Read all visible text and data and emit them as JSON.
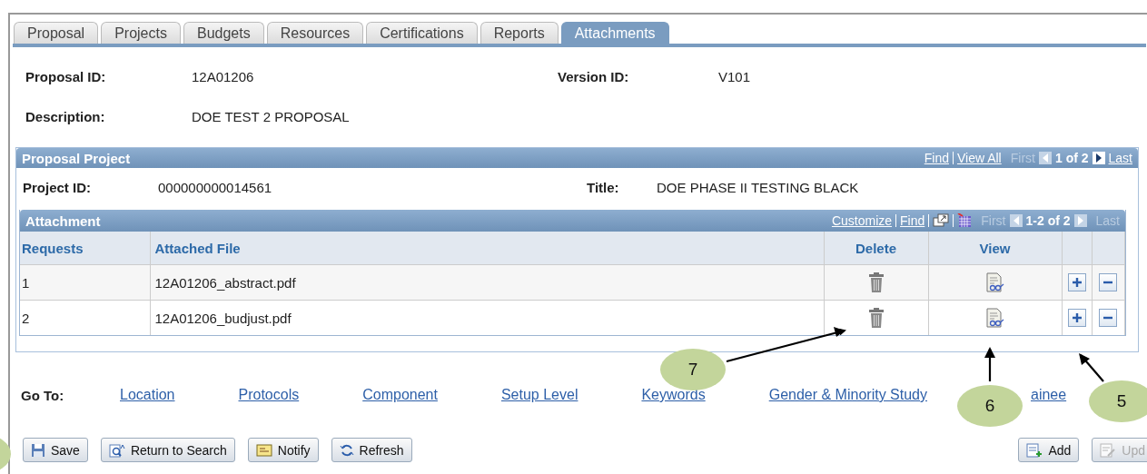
{
  "tabs": [
    {
      "label": "Proposal",
      "selected": false
    },
    {
      "label": "Projects",
      "selected": false
    },
    {
      "label": "Budgets",
      "selected": false
    },
    {
      "label": "Resources",
      "selected": false
    },
    {
      "label": "Certifications",
      "selected": false
    },
    {
      "label": "Reports",
      "selected": false
    },
    {
      "label": "Attachments",
      "selected": true
    }
  ],
  "header": {
    "proposal_id_label": "Proposal ID:",
    "proposal_id": "12A01206",
    "version_id_label": "Version ID:",
    "version_id": "V101",
    "description_label": "Description:",
    "description": "DOE TEST 2 PROPOSAL"
  },
  "proposal_project": {
    "title": "Proposal Project",
    "find": "Find",
    "view_all": "View All",
    "first": "First",
    "count": "1 of 2",
    "last": "Last",
    "project_id_label": "Project ID:",
    "project_id": "000000000014561",
    "title_label": "Title:",
    "project_title": "DOE PHASE II TESTING BLACK"
  },
  "attachment": {
    "title": "Attachment",
    "customize": "Customize",
    "find": "Find",
    "first": "First",
    "count": "1-2 of 2",
    "last": "Last",
    "columns": [
      "Requests",
      "Attached File",
      "Delete",
      "View"
    ],
    "rows": [
      {
        "request": "1",
        "file": "12A01206_abstract.pdf"
      },
      {
        "request": "2",
        "file": "12A01206_budjust.pdf"
      }
    ]
  },
  "goto": {
    "label": "Go To:",
    "links": [
      "Location",
      "Protocols",
      "Component",
      "Setup Level",
      "Keywords",
      "Gender & Minority Study",
      "ainee"
    ]
  },
  "callouts": [
    "7",
    "6",
    "5"
  ],
  "buttons": [
    {
      "label": "Save",
      "disabled": false
    },
    {
      "label": "Return to Search",
      "disabled": false
    },
    {
      "label": "Notify",
      "disabled": false
    },
    {
      "label": "Refresh",
      "disabled": false
    }
  ],
  "right_buttons": [
    {
      "label": "Add",
      "disabled": false
    },
    {
      "label": "Upd",
      "disabled": true
    }
  ]
}
